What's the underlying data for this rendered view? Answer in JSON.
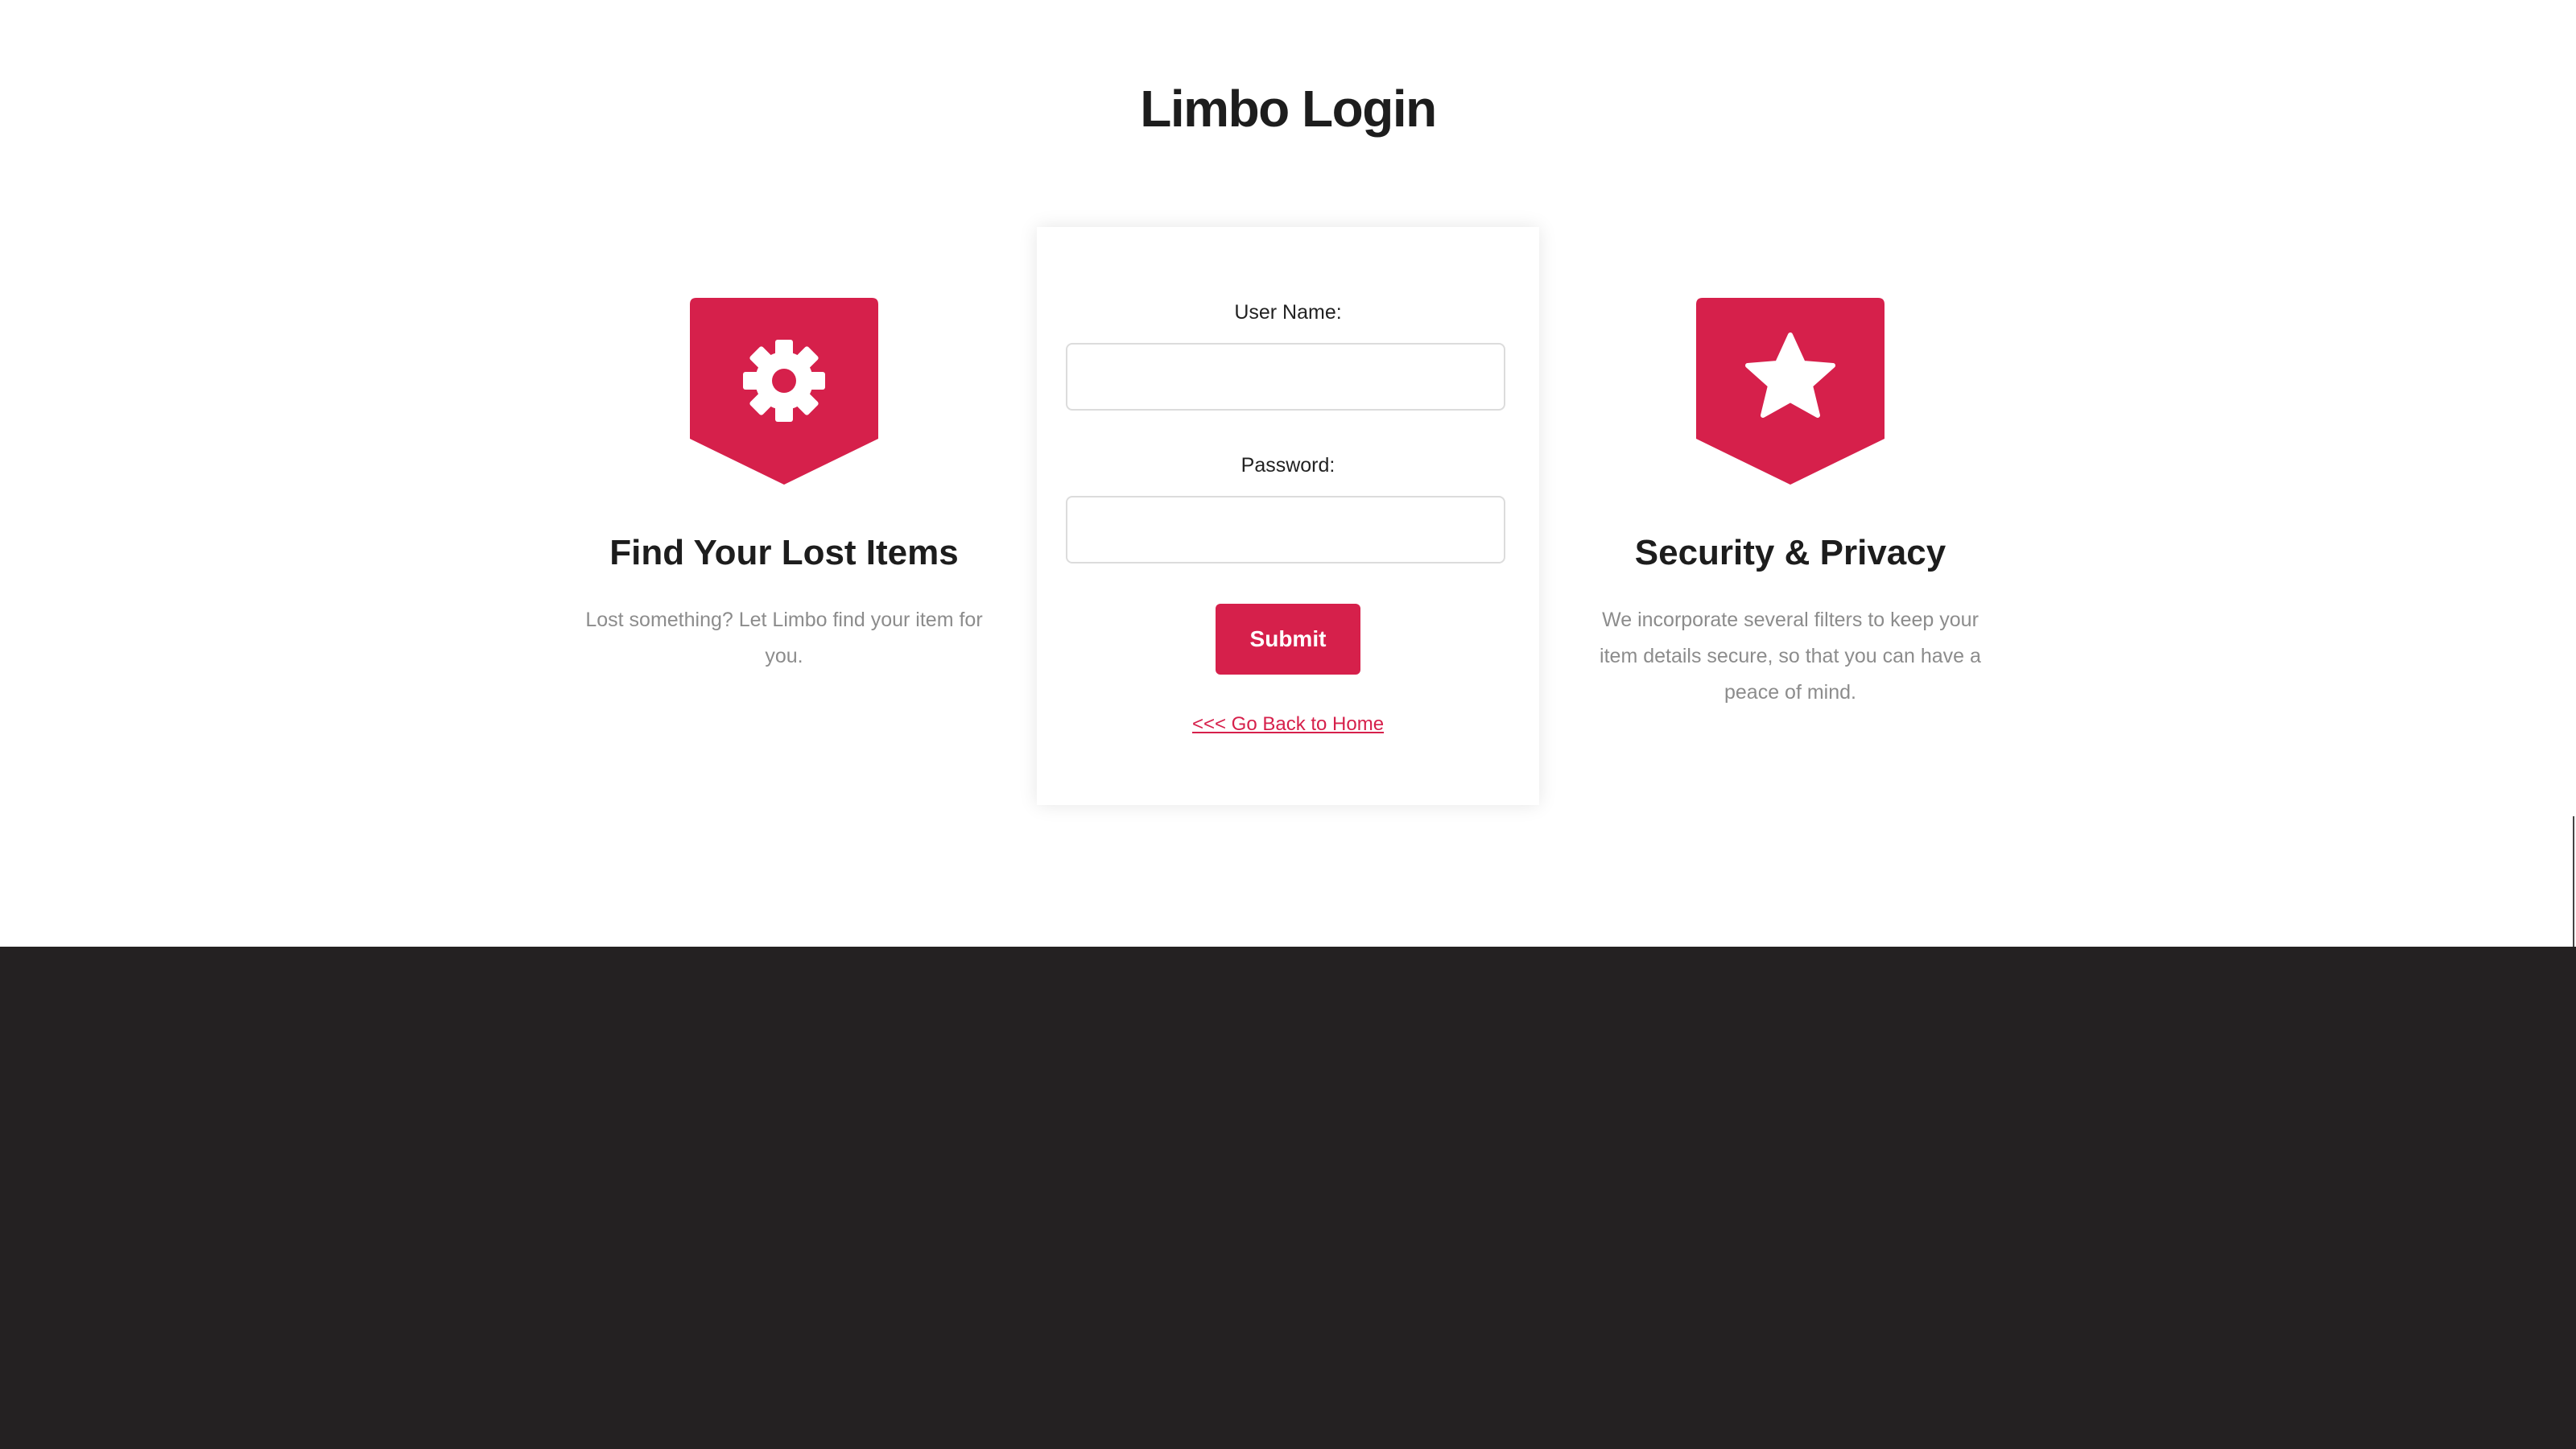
{
  "page": {
    "title": "Limbo Login",
    "accent_color": "#d6204b",
    "footer_color": "#242122"
  },
  "features": [
    {
      "icon": "gear-icon",
      "title": "Find Your Lost Items",
      "text": "Lost something? Let Limbo find your item for you."
    },
    {
      "icon": "star-icon",
      "title": "Security & Privacy",
      "text": "We incorporate several filters to keep your item details secure, so that you can have a peace of mind."
    }
  ],
  "login": {
    "username_label": "User Name:",
    "username_value": "",
    "password_label": "Password:",
    "password_value": "",
    "submit_label": "Submit",
    "back_link": "<<< Go Back to Home"
  }
}
